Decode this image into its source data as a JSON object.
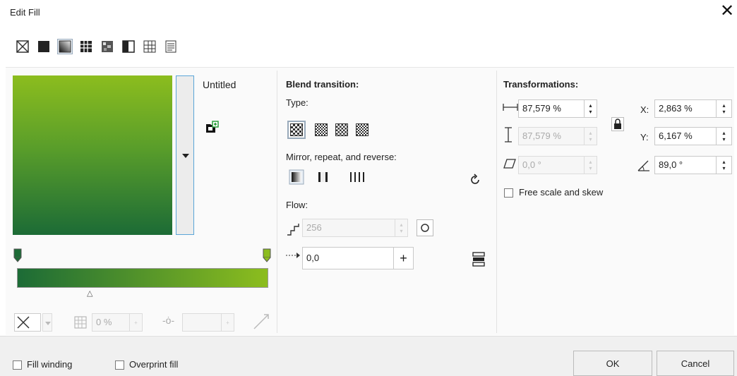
{
  "window": {
    "title": "Edit Fill",
    "close_glyph": "✕"
  },
  "fill_types": [
    {
      "icon": "no-fill-icon"
    },
    {
      "icon": "uniform-fill-icon"
    },
    {
      "icon": "fountain-fill-icon",
      "selected": true
    },
    {
      "icon": "vector-pattern-icon"
    },
    {
      "icon": "bitmap-pattern-icon"
    },
    {
      "icon": "two-color-pattern-icon"
    },
    {
      "icon": "texture-fill-icon"
    },
    {
      "icon": "postscript-fill-icon"
    }
  ],
  "preview": {
    "name": "Untitled",
    "start_color": "#1c6b36",
    "end_color": "#8cbd1e"
  },
  "ramp": {
    "midpoint_glyph": "△"
  },
  "bottom_controls": {
    "transparency": "0 %",
    "plus": "+"
  },
  "blend": {
    "heading": "Blend transition:",
    "type_label": "Type:",
    "mirror_label": "Mirror, repeat, and reverse:",
    "flow_label": "Flow:",
    "steps_value": "256",
    "acceleration_value": "0,0",
    "plus": "+"
  },
  "transformations": {
    "heading": "Transformations:",
    "width_value": "87,579 %",
    "height_value": "87,579 %",
    "skew_value": "0,0 °",
    "x_label": "X:",
    "x_value": "2,863 %",
    "y_label": "Y:",
    "y_value": "6,167 %",
    "rotation_value": "89,0 °",
    "free_scale_label": "Free scale and skew"
  },
  "footer": {
    "fill_winding_label": "Fill winding",
    "overprint_label": "Overprint fill",
    "ok_label": "OK",
    "cancel_label": "Cancel"
  },
  "colors": {
    "accent": "#5aa5d8",
    "dark_green": "#1c6b36",
    "light_green": "#8cbd1e"
  }
}
